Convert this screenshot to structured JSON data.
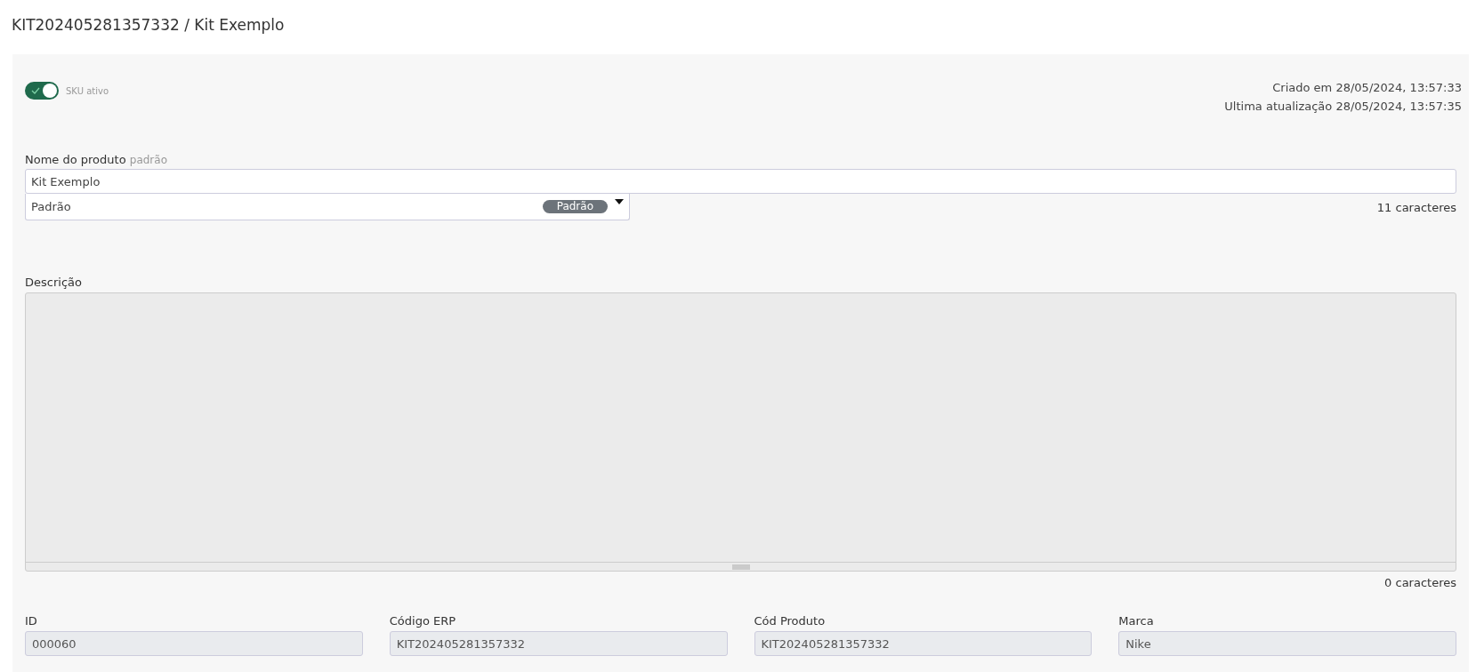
{
  "page_title": "KIT202405281357332 / Kit Exemplo",
  "sku_toggle": {
    "label": "SKU ativo",
    "on": true
  },
  "timestamps": [
    "Criado em 28/05/2024, 13:57:33",
    "Ultima atualização 28/05/2024, 13:57:35"
  ],
  "product_name": {
    "label": "Nome do produto",
    "hint": "padrão",
    "value": "Kit Exemplo",
    "language_select": {
      "value": "Padrão",
      "badge": "Padrão"
    },
    "char_count": "11 caracteres"
  },
  "description": {
    "label": "Descrição",
    "char_count": "0 caracteres"
  },
  "fields": [
    {
      "label": "ID",
      "value": "000060"
    },
    {
      "label": "Código ERP",
      "value": "KIT202405281357332"
    },
    {
      "label": "Cód Produto",
      "value": "KIT202405281357332"
    },
    {
      "label": "Marca",
      "value": "Nike"
    }
  ]
}
